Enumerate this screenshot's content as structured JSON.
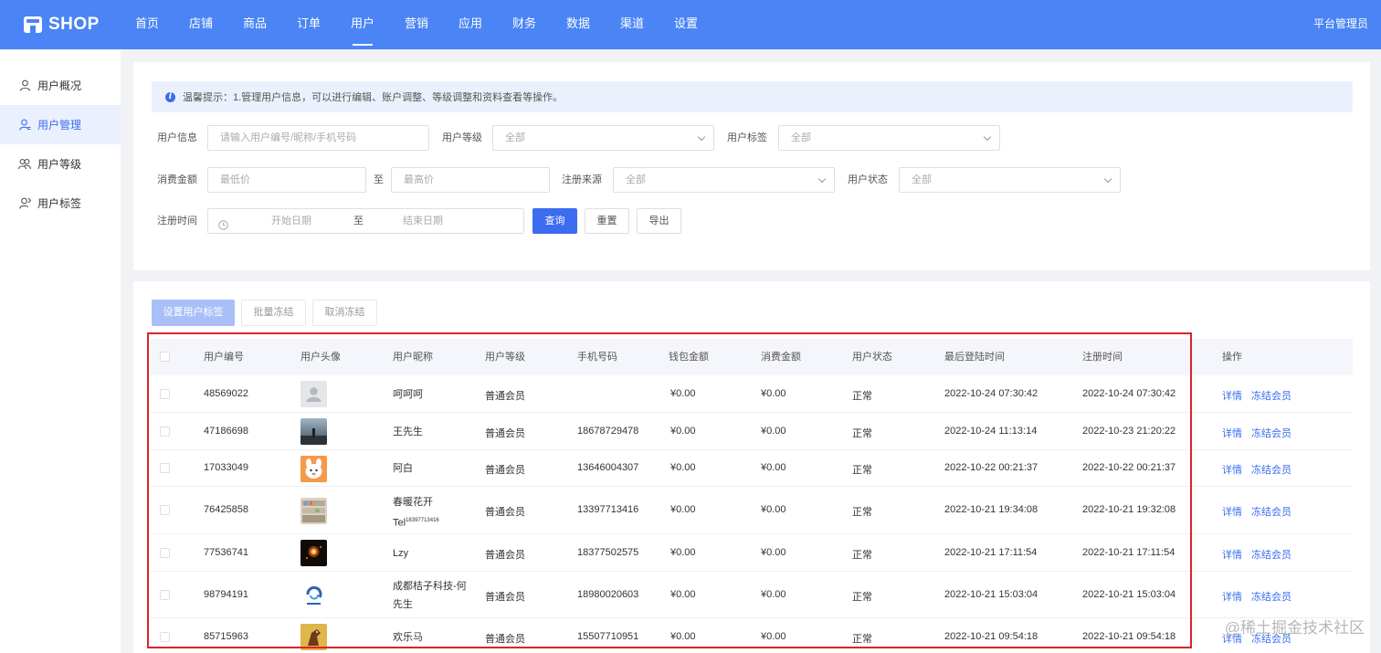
{
  "app": {
    "logo": "SHOP",
    "admin": "平台管理员"
  },
  "nav": [
    "首页",
    "店铺",
    "商品",
    "订单",
    "用户",
    "营销",
    "应用",
    "财务",
    "数据",
    "渠道",
    "设置"
  ],
  "sidebar": [
    {
      "label": "用户概况",
      "icon": "user-icon"
    },
    {
      "label": "用户管理",
      "icon": "user-manage-icon"
    },
    {
      "label": "用户等级",
      "icon": "users-group-icon"
    },
    {
      "label": "用户标签",
      "icon": "user-tag-icon"
    }
  ],
  "tip": "温馨提示：1.管理用户信息，可以进行编辑、账户调整、等级调整和资料查看等操作。",
  "filters": {
    "user_info_label": "用户信息",
    "user_info_placeholder": "请输入用户编号/昵称/手机号码",
    "level_label": "用户等级",
    "level_value": "全部",
    "tag_label": "用户标签",
    "tag_value": "全部",
    "amount_label": "消费金额",
    "min_placeholder": "最低价",
    "to": "至",
    "max_placeholder": "最高价",
    "source_label": "注册来源",
    "source_value": "全部",
    "status_label": "用户状态",
    "status_value": "全部",
    "regtime_label": "注册时间",
    "start_placeholder": "开始日期",
    "end_placeholder": "结束日期",
    "query": "查询",
    "reset": "重置",
    "export": "导出"
  },
  "actions": {
    "set_tag": "设置用户标签",
    "batch_freeze": "批量冻结",
    "unfreeze": "取消冻结"
  },
  "columns": [
    "用户编号",
    "用户头像",
    "用户昵称",
    "用户等级",
    "手机号码",
    "钱包金额",
    "消费金额",
    "用户状态",
    "最后登陆时间",
    "注册时间",
    "操作"
  ],
  "rows": [
    {
      "id": "48569022",
      "avatar": "default",
      "nick": "呵呵呵",
      "nick2": "",
      "level": "普通会员",
      "phone": "",
      "wallet": "¥0.00",
      "spent": "¥0.00",
      "status": "正常",
      "last": "2022-10-24 07:30:42",
      "reg": "2022-10-24 07:30:42"
    },
    {
      "id": "47186698",
      "avatar": "landscape",
      "nick": "王先生",
      "nick2": "",
      "level": "普通会员",
      "phone": "18678729478",
      "wallet": "¥0.00",
      "spent": "¥0.00",
      "status": "正常",
      "last": "2022-10-24 11:13:14",
      "reg": "2022-10-23 21:20:22"
    },
    {
      "id": "17033049",
      "avatar": "cartoon",
      "nick": "阿白",
      "nick2": "",
      "level": "普通会员",
      "phone": "13646004307",
      "wallet": "¥0.00",
      "spent": "¥0.00",
      "status": "正常",
      "last": "2022-10-22 00:21:37",
      "reg": "2022-10-22 00:21:37"
    },
    {
      "id": "76425858",
      "avatar": "shelf",
      "nick": "春暖花开Tel",
      "nick_sup": "18397713416",
      "nick2": "",
      "level": "普通会员",
      "phone": "13397713416",
      "wallet": "¥0.00",
      "spent": "¥0.00",
      "status": "正常",
      "last": "2022-10-21 19:34:08",
      "reg": "2022-10-21 19:32:08"
    },
    {
      "id": "77536741",
      "avatar": "fireworks",
      "nick": "Lzy",
      "nick2": "",
      "level": "普通会员",
      "phone": "18377502575",
      "wallet": "¥0.00",
      "spent": "¥0.00",
      "status": "正常",
      "last": "2022-10-21 17:11:54",
      "reg": "2022-10-21 17:11:54"
    },
    {
      "id": "98794191",
      "avatar": "logo",
      "nick": "成都桔子科技-何",
      "nick2": "先生",
      "level": "普通会员",
      "phone": "18980020603",
      "wallet": "¥0.00",
      "spent": "¥0.00",
      "status": "正常",
      "last": "2022-10-21 15:03:04",
      "reg": "2022-10-21 15:03:04"
    },
    {
      "id": "85715963",
      "avatar": "horse",
      "nick": "欢乐马",
      "nick2": "",
      "level": "普通会员",
      "phone": "15507710951",
      "wallet": "¥0.00",
      "spent": "¥0.00",
      "status": "正常",
      "last": "2022-10-21 09:54:18",
      "reg": "2022-10-21 09:54:18"
    }
  ],
  "row_actions": {
    "detail": "详情",
    "freeze": "冻结会员"
  },
  "watermark": "@稀土掘金技术社区",
  "colors": {
    "primary": "#4a84f5",
    "link": "#3c6cf0",
    "highlight_box": "#d9242e"
  }
}
